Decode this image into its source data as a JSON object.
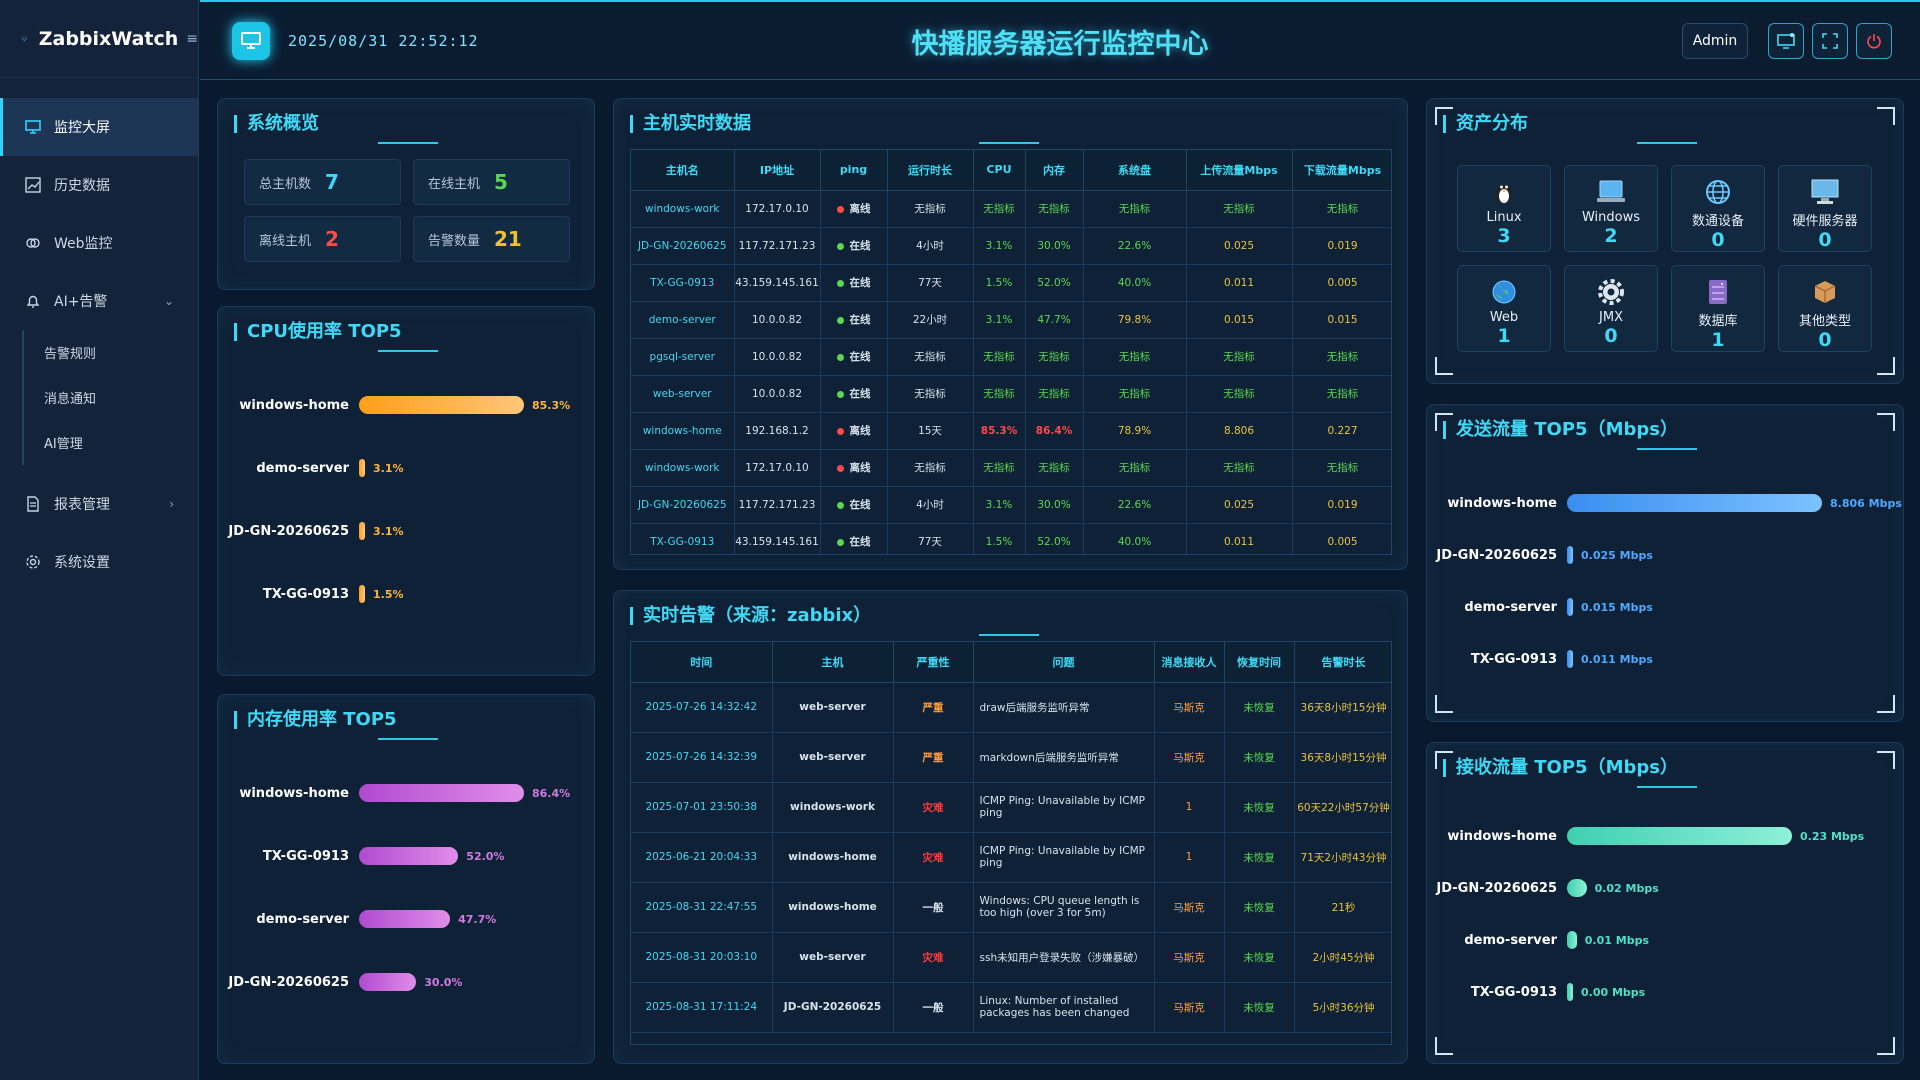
{
  "app": {
    "name": "ZabbixWatch",
    "menu_toggle": "≡"
  },
  "sidebar": {
    "items": [
      {
        "label": "监控大屏",
        "icon": "monitor-icon",
        "active": true
      },
      {
        "label": "历史数据",
        "icon": "chart-icon"
      },
      {
        "label": "Web监控",
        "icon": "link-icon"
      },
      {
        "label": "AI+告警",
        "icon": "bell-icon",
        "expanded": true
      }
    ],
    "sub_items": [
      {
        "label": "告警规则"
      },
      {
        "label": "消息通知"
      },
      {
        "label": "AI管理"
      }
    ],
    "bottom_items": [
      {
        "label": "报表管理",
        "icon": "document-icon"
      },
      {
        "label": "系统设置",
        "icon": "gear-icon"
      }
    ]
  },
  "header": {
    "datetime": "2025/08/31 22:52:12",
    "title": "快播服务器运行监控中心",
    "user": "Admin"
  },
  "overview": {
    "title": "系统概览",
    "stats": [
      {
        "label": "总主机数",
        "value": "7",
        "color": "#3fd8f5"
      },
      {
        "label": "在线主机",
        "value": "5",
        "color": "#5bd84f"
      },
      {
        "label": "离线主机",
        "value": "2",
        "color": "#ff4a4a"
      },
      {
        "label": "告警数量",
        "value": "21",
        "color": "#f0c030"
      }
    ]
  },
  "cpu_top5": {
    "title": "CPU使用率 TOP5",
    "color": "#ff9e1b",
    "items": [
      {
        "name": "windows-home",
        "value": 85.3,
        "label": "85.3%"
      },
      {
        "name": "demo-server",
        "value": 3.1,
        "label": "3.1%"
      },
      {
        "name": "JD-GN-20260625",
        "value": 3.1,
        "label": "3.1%"
      },
      {
        "name": "TX-GG-0913",
        "value": 1.5,
        "label": "1.5%"
      }
    ]
  },
  "mem_top5": {
    "title": "内存使用率 TOP5",
    "color": "#b04ad0",
    "items": [
      {
        "name": "windows-home",
        "value": 86.4,
        "label": "86.4%"
      },
      {
        "name": "TX-GG-0913",
        "value": 52.0,
        "label": "52.0%"
      },
      {
        "name": "demo-server",
        "value": 47.7,
        "label": "47.7%"
      },
      {
        "name": "JD-GN-20260625",
        "value": 30.0,
        "label": "30.0%"
      }
    ]
  },
  "host_table": {
    "title": "主机实时数据",
    "columns": [
      "主机名",
      "IP地址",
      "ping",
      "运行时长",
      "CPU",
      "内存",
      "系统盘",
      "上传流量Mbps",
      "下载流量Mbps"
    ],
    "rows": [
      {
        "host": "windows-work",
        "ip": "172.17.0.10",
        "ping": "离线",
        "online": false,
        "uptime": "无指标",
        "cpu": "无指标",
        "mem": "无指标",
        "disk": "无指标",
        "up": "无指标",
        "down": "无指标"
      },
      {
        "host": "JD-GN-20260625",
        "ip": "117.72.171.23",
        "ping": "在线",
        "online": true,
        "uptime": "4小时",
        "cpu": "3.1%",
        "mem": "30.0%",
        "disk": "22.6%",
        "up": "0.025",
        "down": "0.019"
      },
      {
        "host": "TX-GG-0913",
        "ip": "43.159.145.161",
        "ping": "在线",
        "online": true,
        "uptime": "77天",
        "cpu": "1.5%",
        "mem": "52.0%",
        "disk": "40.0%",
        "up": "0.011",
        "down": "0.005"
      },
      {
        "host": "demo-server",
        "ip": "10.0.0.82",
        "ping": "在线",
        "online": true,
        "uptime": "22小时",
        "cpu": "3.1%",
        "mem": "47.7%",
        "disk": "79.8%",
        "up": "0.015",
        "down": "0.015"
      },
      {
        "host": "pgsql-server",
        "ip": "10.0.0.82",
        "ping": "在线",
        "online": true,
        "uptime": "无指标",
        "cpu": "无指标",
        "mem": "无指标",
        "disk": "无指标",
        "up": "无指标",
        "down": "无指标"
      },
      {
        "host": "web-server",
        "ip": "10.0.0.82",
        "ping": "在线",
        "online": true,
        "uptime": "无指标",
        "cpu": "无指标",
        "mem": "无指标",
        "disk": "无指标",
        "up": "无指标",
        "down": "无指标"
      },
      {
        "host": "windows-home",
        "ip": "192.168.1.2",
        "ping": "离线",
        "online": false,
        "uptime": "15天",
        "cpu": "85.3%",
        "mem": "86.4%",
        "disk": "78.9%",
        "up": "8.806",
        "down": "0.227"
      },
      {
        "host": "windows-work",
        "ip": "172.17.0.10",
        "ping": "离线",
        "online": false,
        "uptime": "无指标",
        "cpu": "无指标",
        "mem": "无指标",
        "disk": "无指标",
        "up": "无指标",
        "down": "无指标"
      },
      {
        "host": "JD-GN-20260625",
        "ip": "117.72.171.23",
        "ping": "在线",
        "online": true,
        "uptime": "4小时",
        "cpu": "3.1%",
        "mem": "30.0%",
        "disk": "22.6%",
        "up": "0.025",
        "down": "0.019"
      },
      {
        "host": "TX-GG-0913",
        "ip": "43.159.145.161",
        "ping": "在线",
        "online": true,
        "uptime": "77天",
        "cpu": "1.5%",
        "mem": "52.0%",
        "disk": "40.0%",
        "up": "0.011",
        "down": "0.005"
      }
    ]
  },
  "alerts": {
    "title": "实时告警（来源：zabbix）",
    "columns": [
      "时间",
      "主机",
      "严重性",
      "问题",
      "消息接收人",
      "恢复时间",
      "告警时长"
    ],
    "rows": [
      {
        "time": "2025-07-26 14:32:42",
        "host": "web-server",
        "severity": "严重",
        "problem": "draw后端服务监听异常",
        "receiver": "马斯克",
        "recovery": "未恢复",
        "duration": "36天8小时15分钟"
      },
      {
        "time": "2025-07-26 14:32:39",
        "host": "web-server",
        "severity": "严重",
        "problem": "markdown后端服务监听异常",
        "receiver": "马斯克",
        "recovery": "未恢复",
        "duration": "36天8小时15分钟"
      },
      {
        "time": "2025-07-01 23:50:38",
        "host": "windows-work",
        "severity": "灾难",
        "problem": "ICMP Ping: Unavailable by ICMP ping",
        "receiver": "1",
        "recovery": "未恢复",
        "duration": "60天22小时57分钟"
      },
      {
        "time": "2025-06-21 20:04:33",
        "host": "windows-home",
        "severity": "灾难",
        "problem": "ICMP Ping: Unavailable by ICMP ping",
        "receiver": "1",
        "recovery": "未恢复",
        "duration": "71天2小时43分钟"
      },
      {
        "time": "2025-08-31 22:47:55",
        "host": "windows-home",
        "severity": "一般",
        "problem": "Windows: CPU queue length is too high (over 3 for 5m)",
        "receiver": "马斯克",
        "recovery": "未恢复",
        "duration": "21秒"
      },
      {
        "time": "2025-08-31 20:03:10",
        "host": "web-server",
        "severity": "灾难",
        "problem": "ssh未知用户登录失败（涉嫌暴破）",
        "receiver": "马斯克",
        "recovery": "未恢复",
        "duration": "2小时45分钟"
      },
      {
        "time": "2025-08-31 17:11:24",
        "host": "JD-GN-20260625",
        "severity": "一般",
        "problem": "Linux: Number of installed packages has been changed",
        "receiver": "马斯克",
        "recovery": "未恢复",
        "duration": "5小时36分钟"
      }
    ]
  },
  "assets": {
    "title": "资产分布",
    "items": [
      {
        "name": "Linux",
        "count": "3",
        "icon": "linux-penguin-icon"
      },
      {
        "name": "Windows",
        "count": "2",
        "icon": "laptop-icon"
      },
      {
        "name": "数通设备",
        "count": "0",
        "icon": "globe-icon"
      },
      {
        "name": "硬件服务器",
        "count": "0",
        "icon": "desktop-icon"
      },
      {
        "name": "Web",
        "count": "1",
        "icon": "earth-icon"
      },
      {
        "name": "JMX",
        "count": "0",
        "icon": "gear-icon"
      },
      {
        "name": "数据库",
        "count": "1",
        "icon": "database-icon"
      },
      {
        "name": "其他类型",
        "count": "0",
        "icon": "package-icon"
      }
    ]
  },
  "send_top5": {
    "title": "发送流量 TOP5（Mbps）",
    "color": "#3a8ef0",
    "items": [
      {
        "name": "windows-home",
        "value": 8.806,
        "label": "8.806 Mbps"
      },
      {
        "name": "JD-GN-20260625",
        "value": 0.025,
        "label": "0.025 Mbps"
      },
      {
        "name": "demo-server",
        "value": 0.015,
        "label": "0.015 Mbps"
      },
      {
        "name": "TX-GG-0913",
        "value": 0.011,
        "label": "0.011 Mbps"
      }
    ]
  },
  "recv_top5": {
    "title": "接收流量 TOP5（Mbps）",
    "color": "#3fd0b0",
    "items": [
      {
        "name": "windows-home",
        "value": 0.23,
        "label": "0.23 Mbps"
      },
      {
        "name": "JD-GN-20260625",
        "value": 0.02,
        "label": "0.02 Mbps"
      },
      {
        "name": "demo-server",
        "value": 0.01,
        "label": "0.01 Mbps"
      },
      {
        "name": "TX-GG-0913",
        "value": 0.0,
        "label": "0.00 Mbps"
      }
    ]
  }
}
